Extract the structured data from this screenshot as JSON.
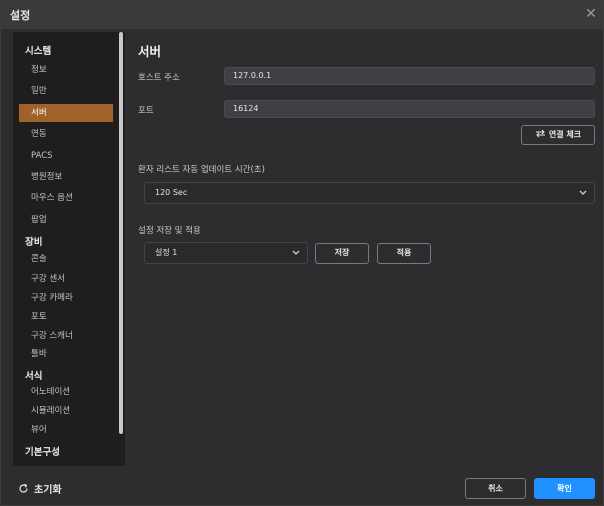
{
  "window": {
    "title": "설정",
    "close_glyph": "✕"
  },
  "sidebar": {
    "groups": [
      {
        "label": "시스템",
        "items": [
          "정보",
          "일반",
          "서버",
          "연동",
          "PACS",
          "병원정보",
          "마우스 옵션",
          "팝업"
        ]
      },
      {
        "label": "장비",
        "items": [
          "콘솔",
          "구강 센서",
          "구강 카메라",
          "포토",
          "구강 스캐너",
          "툴바"
        ]
      },
      {
        "label": "서식",
        "items": [
          "어노테이션",
          "시뮬레이션",
          "뷰어"
        ]
      },
      {
        "label": "기본구성",
        "items": []
      }
    ],
    "active_item": "서버"
  },
  "server": {
    "title": "서버",
    "host_label": "호스트 주소",
    "host_value": "127.0.0.1",
    "port_label": "포트",
    "port_value": "16124",
    "check_button": "연결 체크",
    "auto_update_label": "환자 리스트 자동 업데이트 시간(초)",
    "auto_update_value": "120 Sec",
    "save_apply_label": "설정 저장 및 적용",
    "preset_value": "설정 1",
    "save_button": "저장",
    "apply_button": "적용"
  },
  "footer": {
    "reset_label": "초기화",
    "cancel_button": "취소",
    "confirm_button": "확인"
  },
  "colors": {
    "accent_active": "#a0612a",
    "primary": "#1e90ff",
    "background": "#2d2d30"
  },
  "icons": {
    "close": "close-icon",
    "swap": "swap-arrows-icon",
    "chevron": "chevron-down-icon",
    "reset": "reset-icon"
  }
}
